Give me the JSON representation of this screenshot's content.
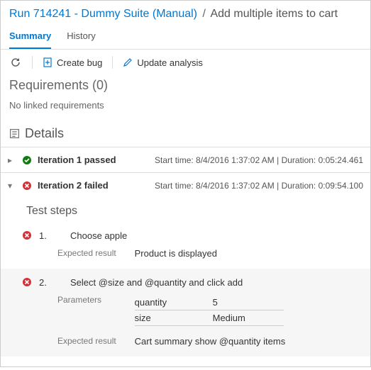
{
  "breadcrumb": {
    "link": "Run 714241 - Dummy Suite (Manual)",
    "current": "Add multiple items to cart"
  },
  "tabs": {
    "summary": "Summary",
    "history": "History"
  },
  "toolbar": {
    "create_bug": "Create bug",
    "update_analysis": "Update analysis"
  },
  "requirements": {
    "title": "Requirements (0)",
    "empty": "No linked requirements"
  },
  "details": {
    "title": "Details"
  },
  "iterations": [
    {
      "label": "Iteration 1 passed",
      "meta": "Start time: 8/4/2016 1:37:02 AM | Duration: 0:05:24.461",
      "status": "passed"
    },
    {
      "label": "Iteration 2 failed",
      "meta": "Start time: 8/4/2016 1:37:02 AM | Duration: 0:09:54.100",
      "status": "failed",
      "steps_title": "Test steps",
      "steps": [
        {
          "num": "1.",
          "action": "Choose apple",
          "expected_label": "Expected result",
          "expected_value": "Product is displayed"
        },
        {
          "num": "2.",
          "action": "Select @size and @quantity and click add",
          "params_label": "Parameters",
          "params": [
            {
              "name": "quantity",
              "value": "5"
            },
            {
              "name": "size",
              "value": "Medium"
            }
          ],
          "expected_label": "Expected result",
          "expected_value": "Cart summary show @quantity items"
        }
      ]
    }
  ]
}
